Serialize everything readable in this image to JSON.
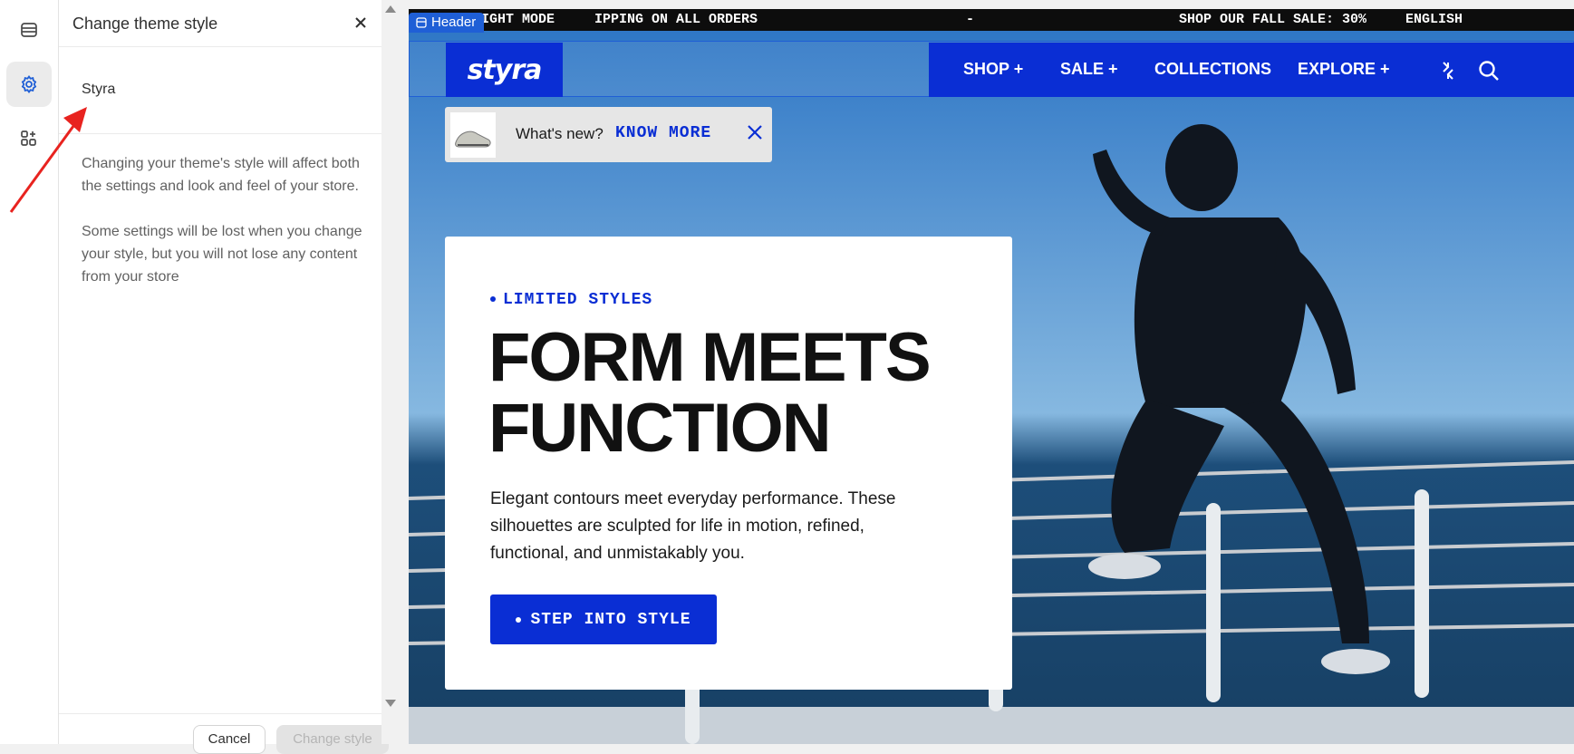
{
  "rail": {
    "items": [
      {
        "name": "sections-icon"
      },
      {
        "name": "settings-icon"
      },
      {
        "name": "apps-icon"
      }
    ]
  },
  "panel": {
    "title": "Change theme style",
    "theme_option": "Styra",
    "description": [
      "Changing your theme's style will affect both the settings and look and feel of your store.",
      "Some settings will be lost when you change your style, but you will not lose any content from your store"
    ],
    "cancel_label": "Cancel",
    "change_label": "Change style"
  },
  "preview": {
    "header_tag": "Header",
    "announcement": [
      "IGHT MODE",
      "IPPING ON ALL ORDERS",
      "-",
      "SHOP OUR FALL SALE: 30%",
      "ENGLISH"
    ],
    "logo": "styra",
    "nav": [
      "SHOP +",
      "SALE +",
      "COLLECTIONS",
      "EXPLORE +"
    ],
    "whats_new": {
      "label": "What's new?",
      "link": "KNOW MORE"
    },
    "hero": {
      "eyebrow": "LIMITED STYLES",
      "headline_line1": "FORM MEETS",
      "headline_line2": "FUNCTION",
      "body": "Elegant contours meet everyday performance. These silhouettes are sculpted for life in motion, refined, functional, and unmistakably you.",
      "cta": "STEP INTO STYLE"
    }
  },
  "colors": {
    "accent_blue": "#0a2ed4",
    "header_outline": "#1f5fd6",
    "annotation_red": "#e8231f"
  }
}
